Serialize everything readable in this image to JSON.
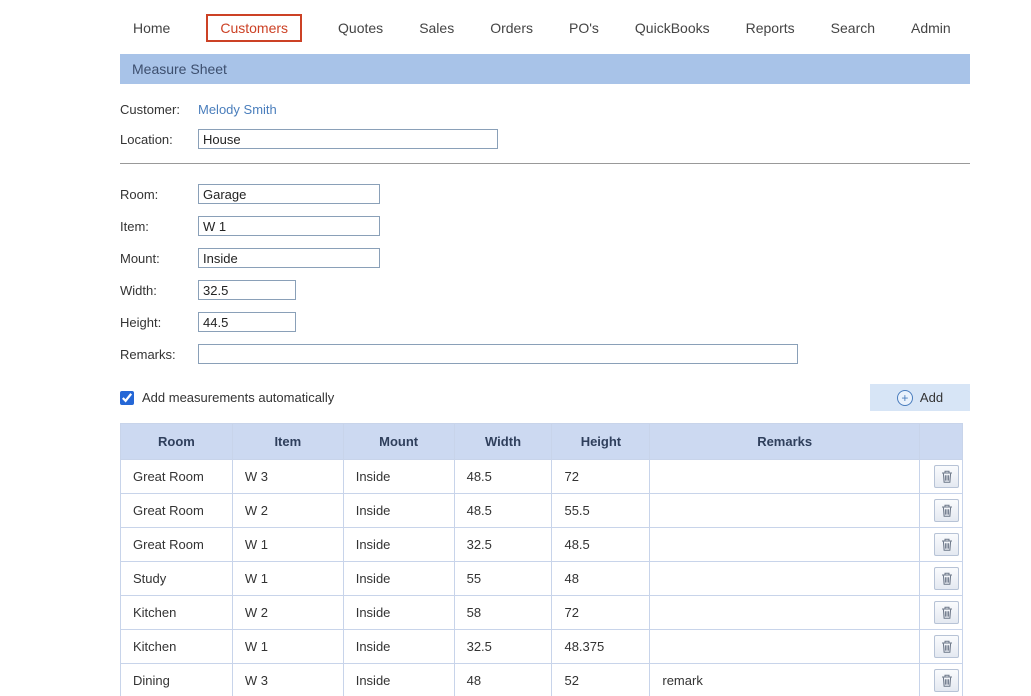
{
  "nav": {
    "items": [
      {
        "label": "Home",
        "active": false
      },
      {
        "label": "Customers",
        "active": true
      },
      {
        "label": "Quotes",
        "active": false
      },
      {
        "label": "Sales",
        "active": false
      },
      {
        "label": "Orders",
        "active": false
      },
      {
        "label": "PO's",
        "active": false
      },
      {
        "label": "QuickBooks",
        "active": false
      },
      {
        "label": "Reports",
        "active": false
      },
      {
        "label": "Search",
        "active": false
      },
      {
        "label": "Admin",
        "active": false
      }
    ]
  },
  "header": {
    "title": "Measure Sheet"
  },
  "form": {
    "customer_label": "Customer:",
    "customer_value": "Melody Smith",
    "location_label": "Location:",
    "location_value": "House",
    "room_label": "Room:",
    "room_value": "Garage",
    "item_label": "Item:",
    "item_value": "W 1",
    "mount_label": "Mount:",
    "mount_value": "Inside",
    "width_label": "Width:",
    "width_value": "32.5",
    "height_label": "Height:",
    "height_value": "44.5",
    "remarks_label": "Remarks:",
    "remarks_value": "",
    "auto_add_label": "Add measurements automatically",
    "auto_add_checked": true,
    "add_button_label": "Add"
  },
  "table": {
    "headers": [
      "Room",
      "Item",
      "Mount",
      "Width",
      "Height",
      "Remarks"
    ],
    "rows": [
      {
        "room": "Great Room",
        "item": "W 3",
        "mount": "Inside",
        "width": "48.5",
        "height": "72",
        "remarks": ""
      },
      {
        "room": "Great Room",
        "item": "W 2",
        "mount": "Inside",
        "width": "48.5",
        "height": "55.5",
        "remarks": ""
      },
      {
        "room": "Great Room",
        "item": "W 1",
        "mount": "Inside",
        "width": "32.5",
        "height": "48.5",
        "remarks": ""
      },
      {
        "room": "Study",
        "item": "W 1",
        "mount": "Inside",
        "width": "55",
        "height": "48",
        "remarks": ""
      },
      {
        "room": "Kitchen",
        "item": "W 2",
        "mount": "Inside",
        "width": "58",
        "height": "72",
        "remarks": ""
      },
      {
        "room": "Kitchen",
        "item": "W 1",
        "mount": "Inside",
        "width": "32.5",
        "height": "48.375",
        "remarks": ""
      },
      {
        "room": "Dining",
        "item": "W 3",
        "mount": "Inside",
        "width": "48",
        "height": "52",
        "remarks": "remark"
      }
    ]
  },
  "colors": {
    "title_bar_bg": "#a8c3e8",
    "table_header_bg": "#ccd9f1",
    "nav_active": "#cc4125",
    "link": "#4a7ebc",
    "add_button_bg": "#d7e5f6"
  }
}
